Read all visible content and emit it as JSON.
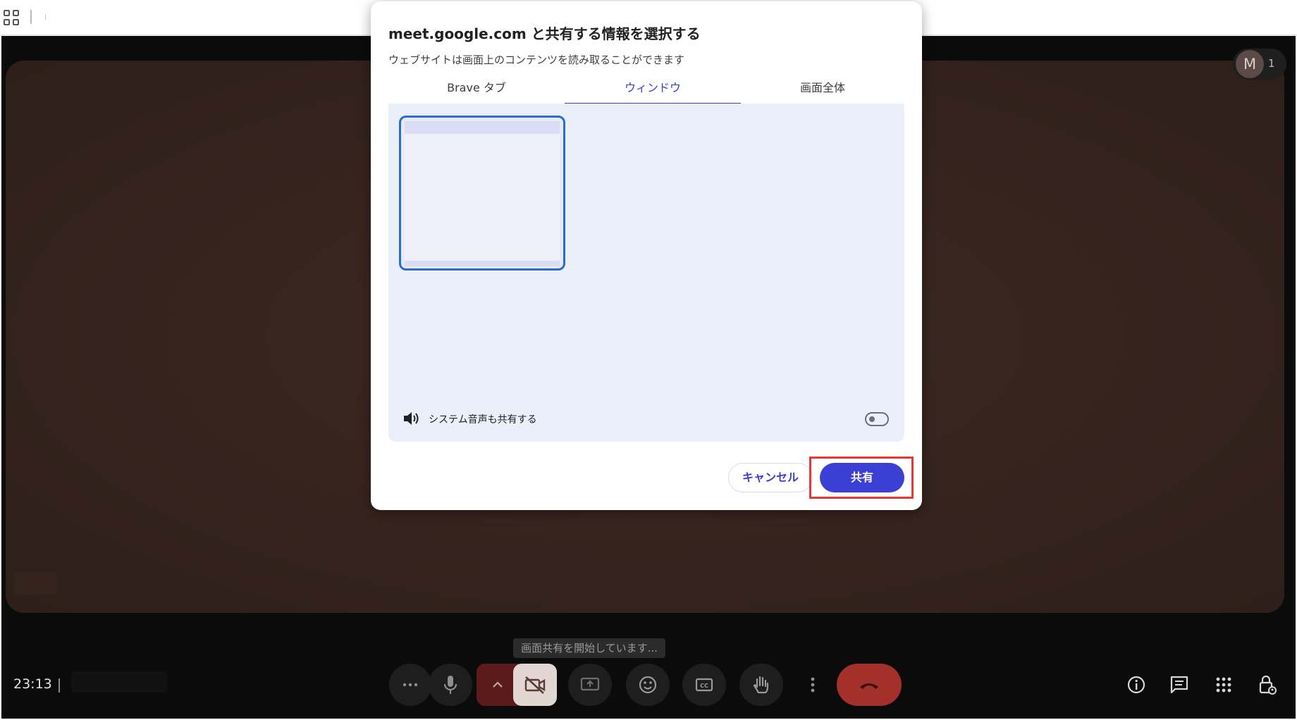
{
  "meet": {
    "clock": "23:13",
    "avatar_initial": "M",
    "participant_count": "1",
    "tooltip": "画面共有を開始しています..."
  },
  "dialog": {
    "title": "meet.google.com と共有する情報を選択する",
    "subtitle": "ウェブサイトは画面上のコンテンツを読み取ることができます",
    "tabs": [
      {
        "label": "Brave タブ",
        "selected": false
      },
      {
        "label": "ウィンドウ",
        "selected": true
      },
      {
        "label": "画面全体",
        "selected": false
      }
    ],
    "audio_label": "システム音声も共有する",
    "audio_toggle_on": false,
    "cancel_label": "キャンセル",
    "share_label": "共有"
  },
  "colors": {
    "accent": "#3c3fd4",
    "hangup": "#a3302a",
    "highlight": "#e53935",
    "panel": "#ebeff9"
  },
  "icons": [
    "apps-grid-icon",
    "more-horiz-icon",
    "mic-icon",
    "chevron-up-icon",
    "camera-off-icon",
    "present-icon",
    "emoji-icon",
    "captions-icon",
    "raise-hand-icon",
    "more-vert-icon",
    "call-end-icon",
    "info-icon",
    "chat-icon",
    "activities-icon",
    "host-controls-icon",
    "speaker-icon"
  ]
}
